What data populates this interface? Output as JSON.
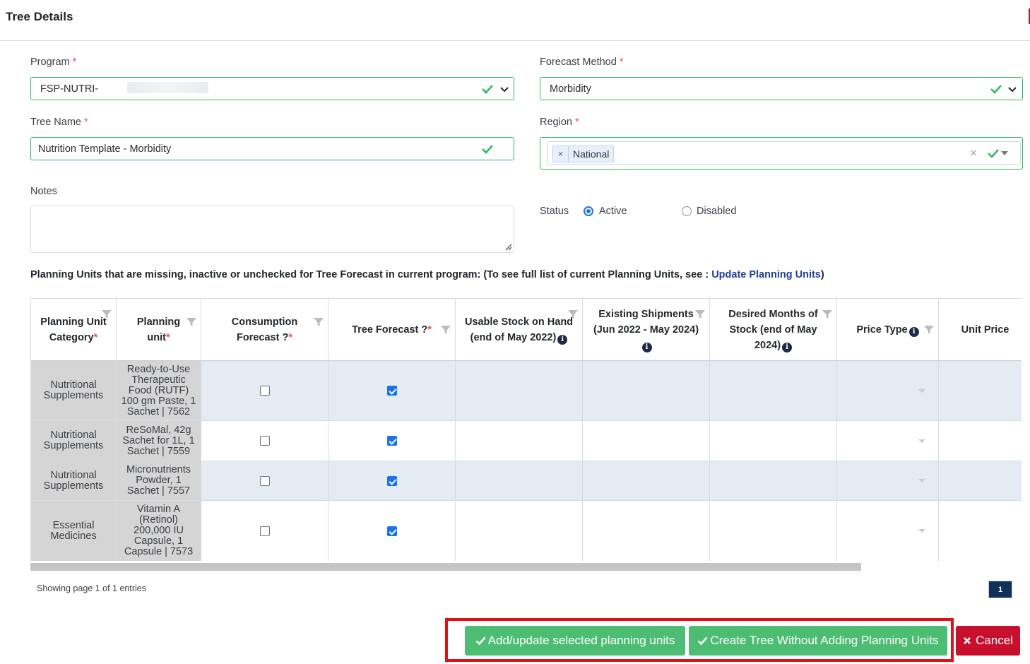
{
  "header": {
    "title": "Tree Details"
  },
  "form": {
    "program": {
      "label": "Program",
      "value": "FSP-NUTRI-"
    },
    "forecast_method": {
      "label": "Forecast Method",
      "value": "Morbidity"
    },
    "tree_name": {
      "label": "Tree Name",
      "value": "Nutrition Template - Morbidity"
    },
    "region": {
      "label": "Region",
      "tag": "National",
      "remove": "×",
      "clear": "×"
    },
    "notes": {
      "label": "Notes",
      "value": ""
    },
    "status": {
      "label": "Status",
      "active": "Active",
      "disabled": "Disabled",
      "selected": "Active"
    },
    "required_mark": "*"
  },
  "planning_note": {
    "text": "Planning Units that are missing, inactive or unchecked for Tree Forecast in current program: (To see full list of current Planning Units, see : ",
    "link": "Update Planning Units",
    "close": ")"
  },
  "table": {
    "headers": [
      {
        "label": "Planning Unit Category",
        "required": true
      },
      {
        "label": "Planning unit",
        "required": true
      },
      {
        "label": "Consumption Forecast ?",
        "required": true
      },
      {
        "label": "Tree Forecast ?",
        "required": true
      },
      {
        "label": "Usable Stock on Hand (end of May 2022)",
        "info": true
      },
      {
        "label": "Existing Shipments (Jun 2022 - May 2024)",
        "info": true
      },
      {
        "label": "Desired Months of Stock (end of May 2024)",
        "info": true
      },
      {
        "label": "Price Type",
        "info": true
      },
      {
        "label": "Unit Price"
      }
    ],
    "rows": [
      {
        "category": "Nutritional Supplements",
        "unit": "Ready-to-Use Therapeutic Food (RUTF) 100 gm Paste, 1 Sachet | 7562",
        "consumption": false,
        "tree": true
      },
      {
        "category": "Nutritional Supplements",
        "unit": "ReSoMal, 42g Sachet for 1L, 1 Sachet | 7559",
        "consumption": false,
        "tree": true
      },
      {
        "category": "Nutritional Supplements",
        "unit": "Micronutrients Powder, 1 Sachet | 7557",
        "consumption": false,
        "tree": true
      },
      {
        "category": "Essential Medicines",
        "unit": "Vitamin A (Retinol) 200,000 IU Capsule, 1 Capsule | 7573",
        "consumption": false,
        "tree": true
      }
    ]
  },
  "pagination": {
    "showing": "Showing page 1 of 1 entries",
    "page": "1"
  },
  "actions": {
    "add_update": "Add/update selected planning units",
    "create_without": "Create Tree Without Adding Planning Units",
    "cancel": "Cancel"
  },
  "colors": {
    "success": "#4dbd74",
    "danger": "#c8102e",
    "highlight": "#e0101a",
    "row_alt": "#e4ebf3"
  }
}
